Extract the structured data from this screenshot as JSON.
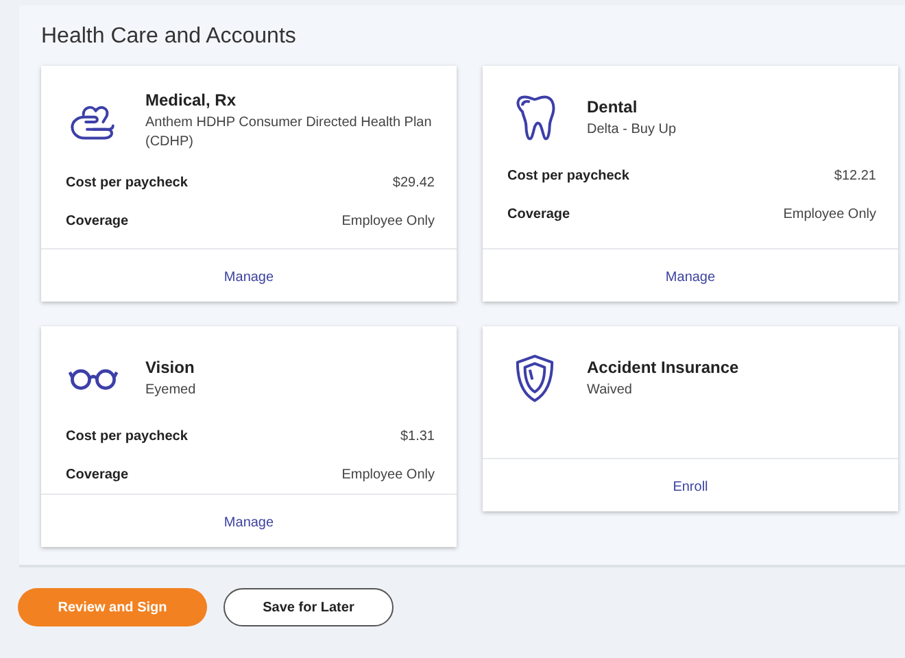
{
  "section": {
    "title": "Health Care and Accounts"
  },
  "cards": [
    {
      "title": "Medical, Rx",
      "subtitle": "Anthem HDHP Consumer Directed Health Plan (CDHP)",
      "details": [
        {
          "label": "Cost per paycheck",
          "value": "$29.42"
        },
        {
          "label": "Coverage",
          "value": "Employee Only"
        }
      ],
      "action": "Manage"
    },
    {
      "title": "Dental",
      "subtitle": "Delta - Buy Up",
      "details": [
        {
          "label": "Cost per paycheck",
          "value": "$12.21"
        },
        {
          "label": "Coverage",
          "value": "Employee Only"
        }
      ],
      "action": "Manage"
    },
    {
      "title": "Vision",
      "subtitle": "Eyemed",
      "details": [
        {
          "label": "Cost per paycheck",
          "value": "$1.31"
        },
        {
          "label": "Coverage",
          "value": "Employee Only"
        }
      ],
      "action": "Manage"
    },
    {
      "title": "Accident Insurance",
      "subtitle": "Waived",
      "action": "Enroll"
    }
  ],
  "buttons": [
    {
      "label": "Review and Sign",
      "kind": "primary"
    },
    {
      "label": "Save for Later",
      "kind": "secondary"
    }
  ]
}
